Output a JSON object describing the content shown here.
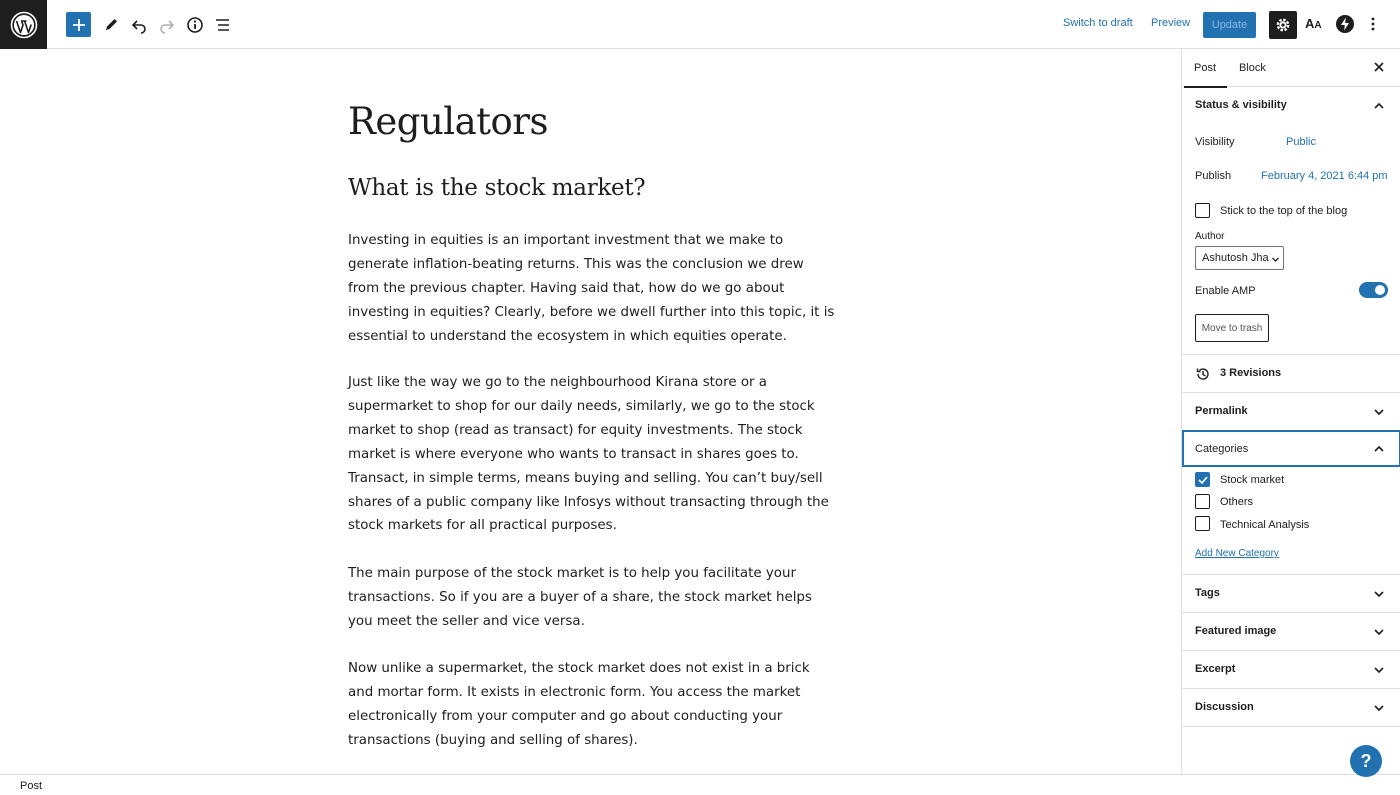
{
  "toolbar": {
    "switch_to_draft": "Switch to draft",
    "preview": "Preview",
    "update": "Update",
    "font_button_a": "A",
    "font_button_small": "A"
  },
  "post": {
    "title": "Regulators",
    "heading": "What is the stock market?",
    "paragraphs": [
      "Investing in equities is an important investment that we make to generate inflation-beating returns. This was the conclusion we drew from the previous chapter. Having said that, how do we go about investing in equities? Clearly, before we dwell further into this topic, it is essential to understand the ecosystem in which equities operate.",
      "Just like the way we go to the neighbourhood Kirana store or a supermarket to shop for our daily needs, similarly, we go to the stock market to shop (read as transact) for equity investments. The stock market is where everyone who wants to transact in shares goes to. Transact, in simple terms, means buying and selling. You can’t buy/sell shares of a public company like Infosys without transacting through the stock markets for all practical purposes.",
      "The main purpose of the stock market is to help you facilitate your transactions. So if you are a buyer of a share, the stock market helps you meet the seller and vice versa.",
      "Now unlike a supermarket, the stock market does not exist in a brick and mortar form. It exists in electronic form. You access the market electronically from your computer and go about conducting your transactions (buying and selling of shares)."
    ]
  },
  "sidebar": {
    "tabs": {
      "post": "Post",
      "block": "Block"
    },
    "status": {
      "title": "Status & visibility",
      "visibility_label": "Visibility",
      "visibility_value": "Public",
      "publish_label": "Publish",
      "publish_value": "February 4, 2021 6:44 pm",
      "sticky_label": "Stick to the top of the blog",
      "author_label": "Author",
      "author_value": "Ashutosh Jha",
      "amp_label": "Enable AMP",
      "amp_enabled": true,
      "trash_label": "Move to trash"
    },
    "revisions": "3 Revisions",
    "permalink": "Permalink",
    "categories": {
      "title": "Categories",
      "items": [
        {
          "label": "Stock market",
          "checked": true
        },
        {
          "label": "Others",
          "checked": false
        },
        {
          "label": "Technical Analysis",
          "checked": false
        }
      ],
      "add_new": "Add New Category"
    },
    "tags": "Tags",
    "featured_image": "Featured image",
    "excerpt": "Excerpt",
    "discussion": "Discussion"
  },
  "footer": {
    "breadcrumb": "Post"
  },
  "help": {
    "label": "?"
  },
  "colors": {
    "accent": "#2271b1",
    "dark": "#1e1e1e",
    "border": "#e0e0e0"
  }
}
